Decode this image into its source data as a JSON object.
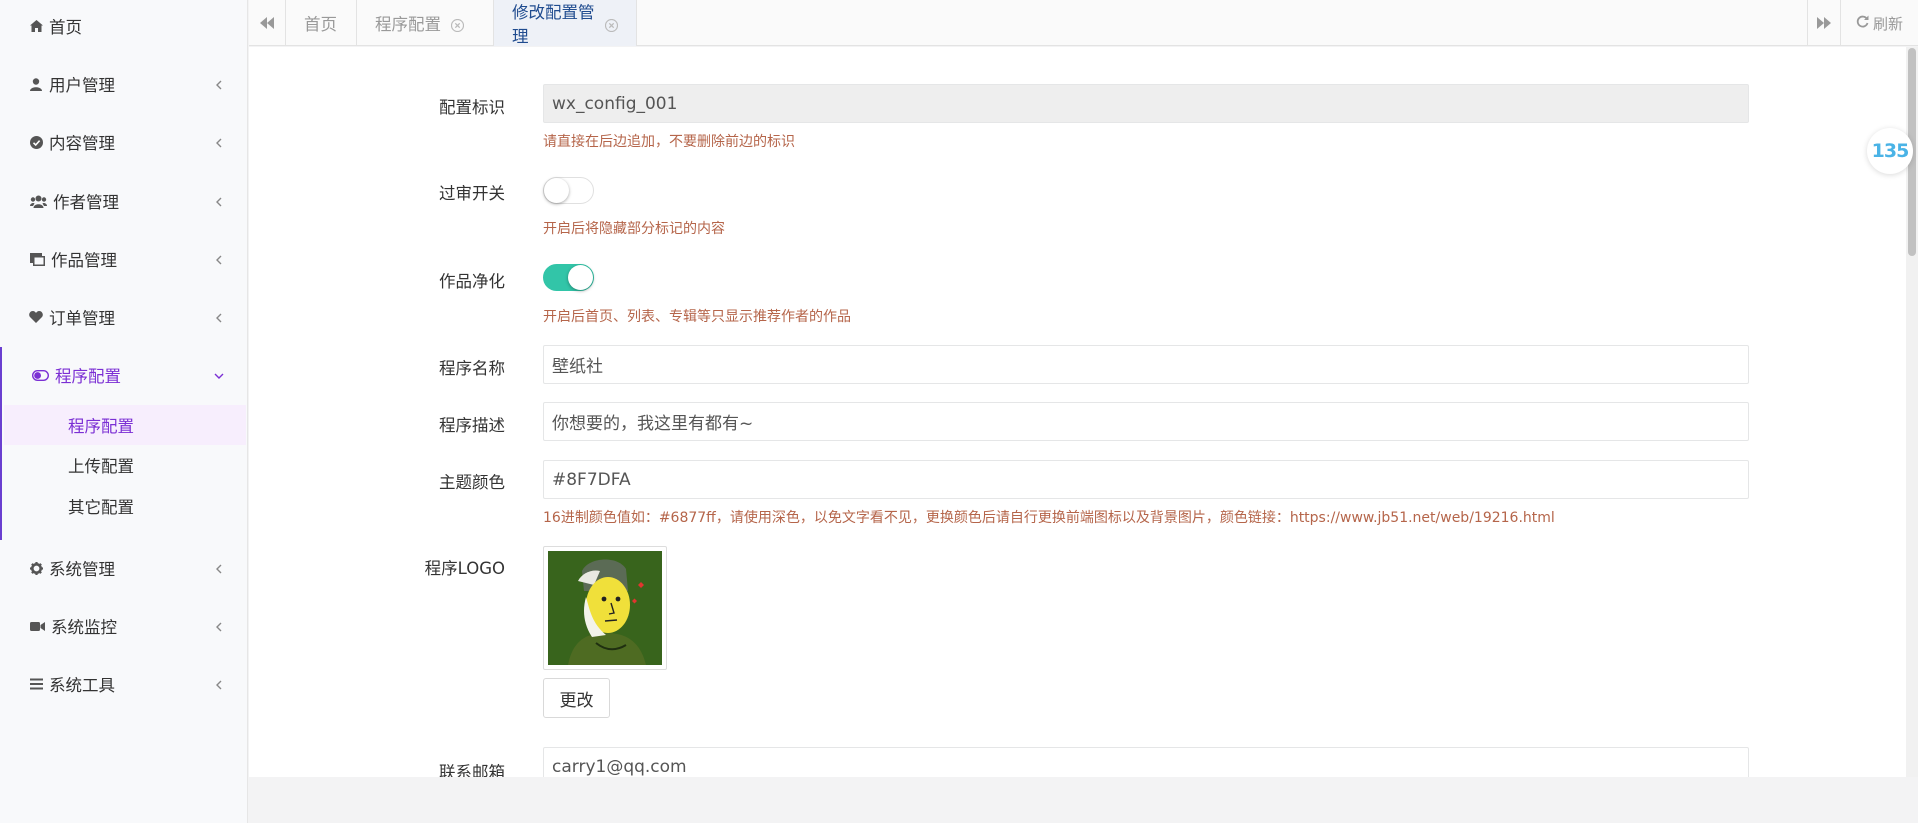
{
  "sidebar": {
    "items": [
      {
        "label": "首页",
        "icon": "home-icon"
      },
      {
        "label": "用户管理",
        "icon": "user-icon"
      },
      {
        "label": "内容管理",
        "icon": "check-circle-icon"
      },
      {
        "label": "作者管理",
        "icon": "users-icon"
      },
      {
        "label": "作品管理",
        "icon": "image-icon"
      },
      {
        "label": "订单管理",
        "icon": "heart-icon"
      },
      {
        "label": "程序配置",
        "icon": "toggle-icon"
      },
      {
        "label": "系统管理",
        "icon": "gear-icon"
      },
      {
        "label": "系统监控",
        "icon": "video-camera-icon"
      },
      {
        "label": "系统工具",
        "icon": "bars-icon"
      }
    ],
    "sub_items": [
      {
        "label": "程序配置"
      },
      {
        "label": "上传配置"
      },
      {
        "label": "其它配置"
      }
    ]
  },
  "tabs": {
    "items": [
      {
        "label": "首页"
      },
      {
        "label": "程序配置"
      },
      {
        "label": "修改配置管理"
      }
    ],
    "refresh_label": "刷新"
  },
  "form": {
    "config_id": {
      "label": "配置标识",
      "value": "wx_config_001",
      "help": "请直接在后边追加，不要删除前边的标识"
    },
    "review_switch": {
      "label": "过审开关",
      "state": "off",
      "help": "开启后将隐藏部分标记的内容"
    },
    "purify_switch": {
      "label": "作品净化",
      "state": "on",
      "help": "开启后首页、列表、专辑等只显示推荐作者的作品"
    },
    "app_name": {
      "label": "程序名称",
      "value": "壁纸社"
    },
    "app_desc": {
      "label": "程序描述",
      "value": "你想要的，我这里有都有~"
    },
    "theme_color": {
      "label": "主题颜色",
      "value": "#8F7DFA",
      "help": "16进制颜色值如：#6877ff，请使用深色，以免文字看不见，更换颜色后请自行更换前端图标以及背景图片，颜色链接：https://www.jb51.net/web/19216.html"
    },
    "logo": {
      "label": "程序LOGO",
      "button": "更改"
    },
    "email": {
      "label": "联系邮箱",
      "value": "carry1@qq.com"
    }
  },
  "badge": {
    "text": "135"
  },
  "colors": {
    "accent": "#7b2fd4",
    "switch_on": "#32c5a8",
    "help_text": "#b5654a",
    "active_tab_text": "#1f4b8f"
  }
}
